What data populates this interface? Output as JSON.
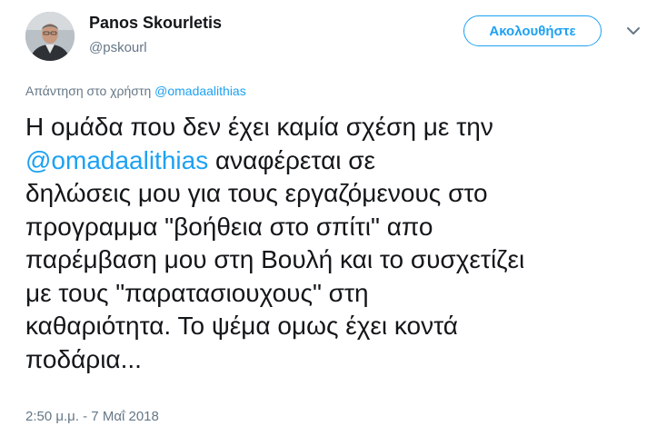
{
  "author": {
    "display_name": "Panos Skourletis",
    "handle": "@pskourl"
  },
  "follow_button": {
    "label": "Ακολουθήστε"
  },
  "reply_to": {
    "prefix": "Απάντηση στο χρήστη",
    "mention": "@omadaalithias"
  },
  "tweet": {
    "line1": "Η ομάδα που δεν έχει καμία σχέση με την",
    "mention": "@omadaalithias",
    "line2_rest": " αναφέρεται σε",
    "line3": "δηλώσεις μου για τους εργαζόμενους στο",
    "line4": "προγραμμα \"βοήθεια στο σπίτι\" απο",
    "line5": "παρέμβαση μου στη Βουλή και το συσχετίζει",
    "line6": "με τους \"παρατασιουχους\" στη",
    "line7": "καθαριότητα. Το ψέμα ομως έχει κοντά",
    "line8": "ποδάρια..."
  },
  "timestamp": "2:50 μ.μ. - 7 Μαΐ 2018",
  "colors": {
    "accent": "#1da1f2",
    "secondary_text": "#657786",
    "primary_text": "#14171a"
  },
  "icons": {
    "caret": "chevron-down-icon",
    "avatar": "profile-photo"
  }
}
